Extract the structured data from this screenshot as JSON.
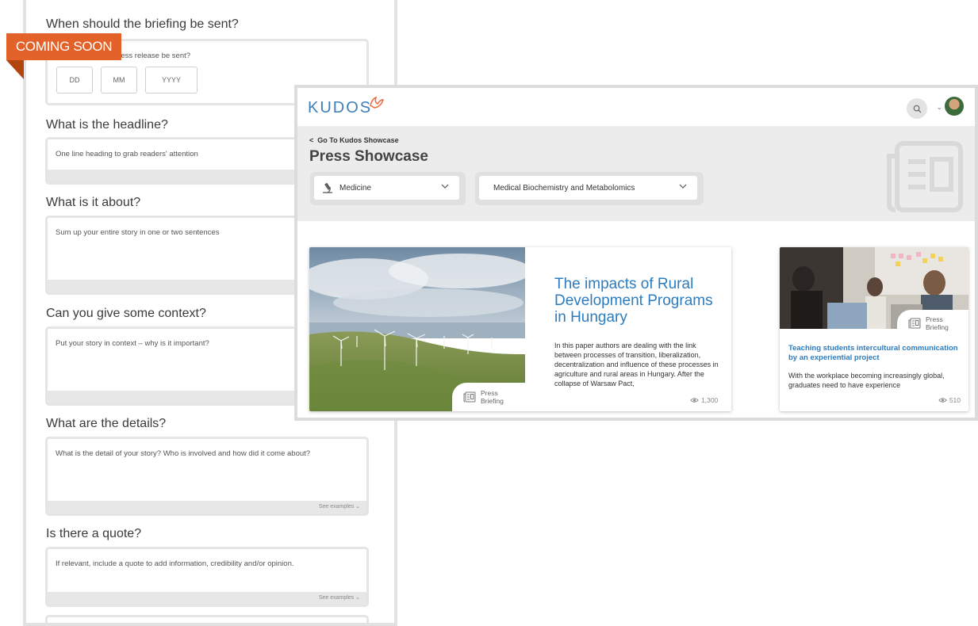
{
  "form": {
    "ribbon": "COMING SOON",
    "q1": {
      "title": "When should the briefing be sent?",
      "sub": "When should the press release be sent?",
      "dd": "DD",
      "mm": "MM",
      "yyyy": "YYYY"
    },
    "q2": {
      "title": "What is the headline?",
      "placeholder": "One line heading to grab readers' attention"
    },
    "q3": {
      "title": "What is it about?",
      "placeholder": "Sum up your entire story in one or two sentences"
    },
    "q4": {
      "title": "Can you give some context?",
      "placeholder": "Put your story in context – why is it important?"
    },
    "q5": {
      "title": "What are the details?",
      "placeholder": "What is the detail of your story? Who is involved and how did it come about?",
      "see_examples": "See examples"
    },
    "q6": {
      "title": "Is there a quote?",
      "placeholder": "If relevant, include a quote to add information, credibility and/or opinion.",
      "see_examples": "See examples"
    }
  },
  "showcase": {
    "logo": "KUDOS",
    "back_link": "Go To Kudos Showcase",
    "page_title": "Press Showcase",
    "filter1": "Medicine",
    "filter2": "Medical Biochemistry and Metabolomics",
    "card1": {
      "title": "The impacts of Rural Development Programs in Hungary",
      "desc": "In this paper authors are dealing with the link between processes of transition, liberalization, decentralization and influence of these processes in agriculture and rural areas in Hungary. After the collapse of Warsaw Pact,",
      "tag_line1": "Press",
      "tag_line2": "Briefing",
      "views": "1,300"
    },
    "card2": {
      "title": "Teaching students intercultural communication by an experiential project",
      "desc": "With the workplace becoming increasingly global, graduates need to have experience",
      "tag_line1": "Press",
      "tag_line2": "Briefing",
      "views": "510"
    }
  },
  "colors": {
    "accent_orange": "#e3622a",
    "link_blue": "#2c7cbf",
    "logo_blue": "#3d7fb8"
  },
  "icons": [
    "search-icon",
    "chevron-down-icon",
    "chevron-left-icon",
    "microscope-icon",
    "newspaper-icon",
    "eye-icon",
    "avatar"
  ]
}
